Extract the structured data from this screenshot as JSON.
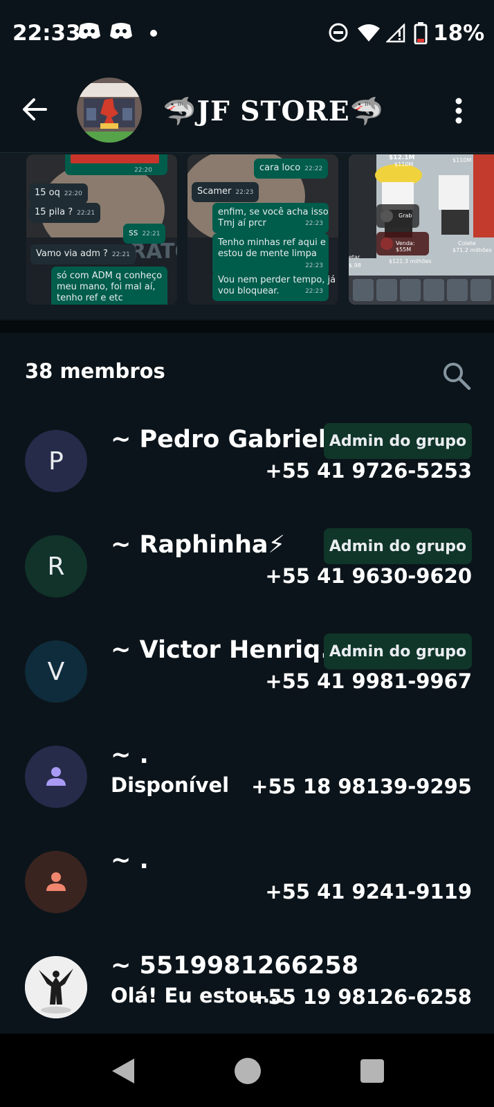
{
  "status_bar": {
    "time": "22:33",
    "battery": "18%",
    "icons": [
      "discord-icon",
      "discord-icon",
      "notification-dot-icon",
      "dnd-icon",
      "wifi-icon",
      "signal-icon",
      "battery-icon"
    ]
  },
  "header": {
    "back_icon": "arrow-left-icon",
    "group_name": "🦈JF STORE🦈",
    "menu_icon": "more-vert-icon"
  },
  "media": {
    "thumb1": [
      {
        "text": "15 oq",
        "time": "22:20",
        "dir": "in"
      },
      {
        "text": "15 pila ?",
        "time": "22:21",
        "dir": "in"
      },
      {
        "text": "ss",
        "time": "22:21",
        "dir": "out"
      },
      {
        "text": "Vamo via adm ?",
        "time": "22:21",
        "dir": "in"
      },
      {
        "text": "só com ADM q conheço",
        "dir": "out"
      },
      {
        "text": "meu mano, foi mal aí,",
        "dir": "out"
      },
      {
        "text": "tenho ref e etc",
        "dir": "out"
      },
      {
        "time": "22:20"
      }
    ],
    "thumb2": [
      {
        "text": "cara loco",
        "time": "22:22",
        "dir": "out"
      },
      {
        "text": "Scamer",
        "time": "22:23",
        "dir": "in"
      },
      {
        "text": "enfim, se você acha isso",
        "dir": "out"
      },
      {
        "text": "Tmj aí prcr",
        "time": "22:23",
        "dir": "out"
      },
      {
        "text": "Tenho minhas ref aqui e",
        "dir": "out"
      },
      {
        "text": "estou de mente limpa",
        "time": "22:23",
        "dir": "out"
      },
      {
        "text": "Vou nem perder tempo, já",
        "dir": "out"
      },
      {
        "text": "vou bloquear.",
        "time": "22:23",
        "dir": "out"
      }
    ],
    "thumb3": {
      "labels": [
        "$12.1M",
        "$110M",
        "$110M",
        "Grab",
        "Venda: $55M",
        "Colete",
        "$71.2 milhões",
        "$121.3 milhões",
        "etar",
        "$.98"
      ]
    }
  },
  "members": {
    "count_label": "38 membros",
    "search_icon": "search-icon",
    "list": [
      {
        "initial": "P",
        "name": "~ Pedro Gabriel",
        "badge": "Admin do grupo",
        "phone": "+55 41 9726-5253",
        "status": "",
        "avatar_bg": "#262b4a",
        "avatar_fg": "#e9edef"
      },
      {
        "initial": "R",
        "name": "~ Raphinha⚡",
        "badge": "Admin do grupo",
        "phone": "+55 41 9630-9620",
        "status": "",
        "avatar_bg": "#11332a",
        "avatar_fg": "#e9edef"
      },
      {
        "initial": "V",
        "name": "~ Victor Henriq...",
        "badge": "Admin do grupo",
        "phone": "+55 41 9981-9967",
        "status": "",
        "avatar_bg": "#0f2c3c",
        "avatar_fg": "#e9edef"
      },
      {
        "initial": "",
        "name": "~ .",
        "badge": "",
        "phone": "+55 18 98139-9295",
        "status": "Disponível",
        "avatar_bg": "#262b4a",
        "avatar_fg": "#a99af6"
      },
      {
        "initial": "",
        "name": "~ .",
        "badge": "",
        "phone": "+55 41 9241-9119",
        "status": "",
        "avatar_bg": "#3a2420",
        "avatar_fg": "#f0866e"
      },
      {
        "initial": "",
        "name": "~ 5519981266258",
        "badge": "",
        "phone": "+55 19 98126-6258",
        "status": "Olá! Eu estou...",
        "avatar_bg": "#ececec",
        "avatar_fg": "#222"
      }
    ]
  },
  "nav": {
    "back_icon": "nav-back-icon",
    "home_icon": "nav-home-icon",
    "recents_icon": "nav-recents-icon"
  }
}
